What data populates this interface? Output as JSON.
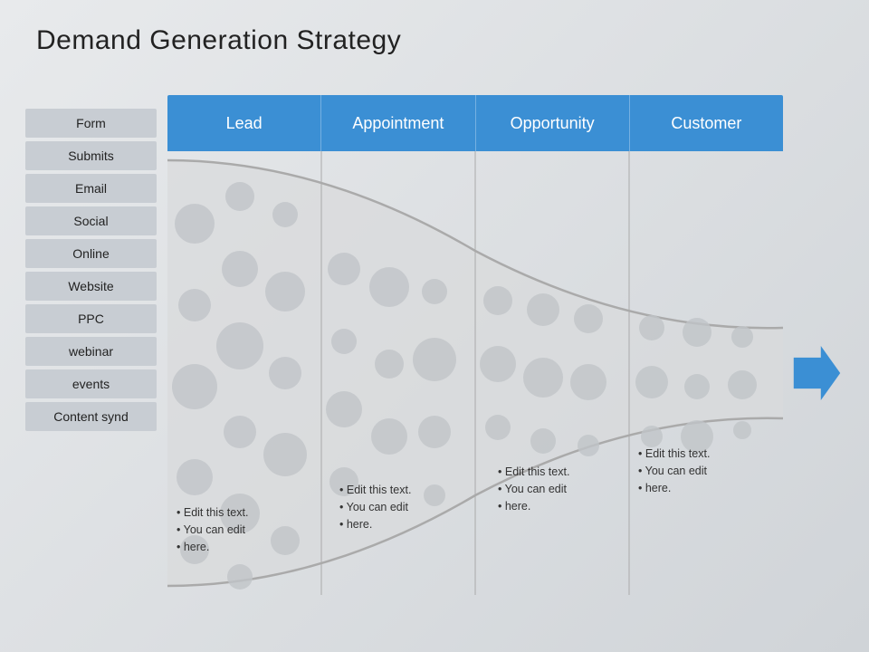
{
  "page": {
    "title": "Demand Generation Strategy"
  },
  "sidebar": {
    "items": [
      {
        "label": "Form"
      },
      {
        "label": "Submits"
      },
      {
        "label": "Email"
      },
      {
        "label": "Social"
      },
      {
        "label": "Online"
      },
      {
        "label": "Website"
      },
      {
        "label": "PPC"
      },
      {
        "label": "webinar"
      },
      {
        "label": "events"
      },
      {
        "label": "Content synd"
      }
    ]
  },
  "header": {
    "columns": [
      "Lead",
      "Appointment",
      "Opportunity",
      "Customer"
    ]
  },
  "annotations": [
    {
      "id": "lead-text",
      "lines": [
        "Edit this text.",
        "You can edit",
        "here."
      ]
    },
    {
      "id": "appointment-text",
      "lines": [
        "Edit this text.",
        "You can edit",
        "here."
      ]
    },
    {
      "id": "opportunity-text",
      "lines": [
        "Edit this text.",
        "You can edit",
        "here."
      ]
    },
    {
      "id": "customer-text",
      "lines": [
        "Edit this text.",
        "You can edit",
        "here."
      ]
    }
  ],
  "colors": {
    "blue": "#3b8fd4",
    "sidebar_bg": "#c8cdd3",
    "funnel_fill": "#d8dadc",
    "funnel_stroke": "#aaaaaa",
    "circle_fill": "#c8ccc e",
    "page_bg_start": "#e8eaec",
    "page_bg_end": "#d0d4d8"
  }
}
